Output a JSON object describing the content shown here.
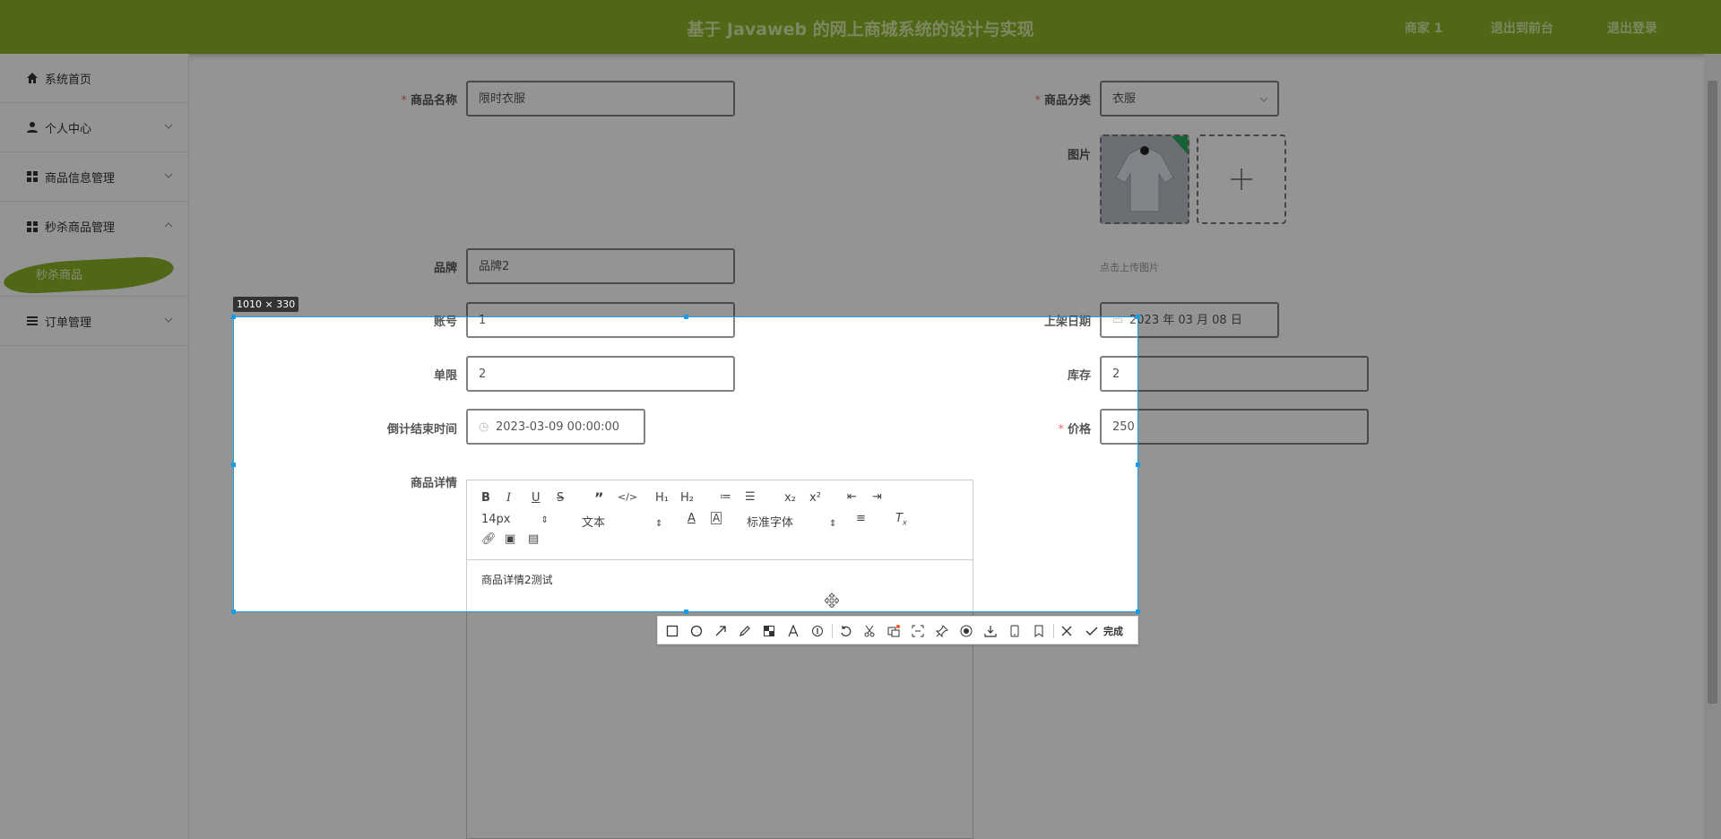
{
  "header": {
    "title": "基于 Javaweb 的网上商城系统的设计与实现",
    "nav": [
      "商家 1",
      "退出到前台",
      "退出登录"
    ]
  },
  "sidebar": {
    "items": [
      {
        "label": "系统首页",
        "icon": "home-icon"
      },
      {
        "label": "个人中心",
        "icon": "user-icon",
        "chevron": "down"
      },
      {
        "label": "商品信息管理",
        "icon": "grid-icon",
        "chevron": "down"
      },
      {
        "label": "秒杀商品管理",
        "icon": "grid-icon",
        "chevron": "up"
      },
      {
        "label": "订单管理",
        "icon": "list-icon",
        "chevron": "down"
      }
    ],
    "sub_item": "秒杀商品"
  },
  "form": {
    "name_label": "商品名称",
    "name_value": "限时衣服",
    "category_label": "商品分类",
    "category_value": "衣服",
    "image_label": "图片",
    "image_hint": "点击上传图片",
    "brand_label": "品牌",
    "brand_value": "品牌2",
    "account_label": "账号",
    "account_value": "1",
    "date_label": "上架日期",
    "date_value": "2023 年 03 月 08 日",
    "limit_label": "单限",
    "limit_value": "2",
    "stock_label": "库存",
    "stock_value": "2",
    "countdown_label": "倒计结束时间",
    "countdown_value": "2023-03-09 00:00:00",
    "price_label": "价格",
    "price_value": "250",
    "detail_label": "商品详情"
  },
  "editor": {
    "font_size": "14px",
    "header_select": "文本",
    "font_family": "标准字体",
    "content": "商品详情2测试"
  },
  "capture": {
    "size": "1010 × 330",
    "done_label": "完成"
  },
  "colors": {
    "header_bg": "#8ab125",
    "selection": "#1a9be6",
    "required": "#f56c6c"
  }
}
